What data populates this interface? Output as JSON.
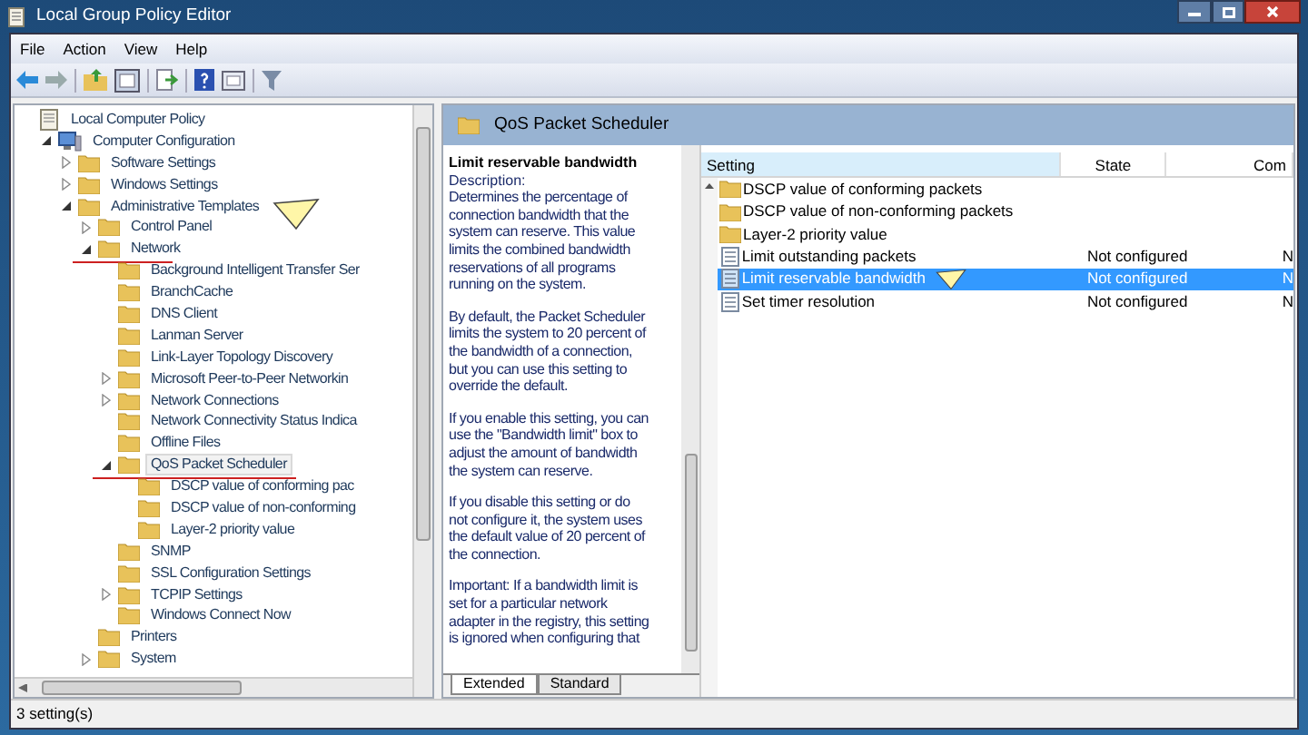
{
  "window": {
    "title": "Local Group Policy Editor"
  },
  "menu": [
    "File",
    "Action",
    "View",
    "Help"
  ],
  "tree": [
    {
      "label": "Local Computer Policy",
      "selected": false,
      "children": [
        {
          "label": "Computer Configuration",
          "expanded": true,
          "selected": false,
          "children": [
            {
              "label": "Software Settings",
              "expanded": false,
              "selected": false
            },
            {
              "label": "Windows Settings",
              "expanded": false,
              "selected": false
            },
            {
              "label": "Administrative Templates",
              "expanded": true,
              "selected": false,
              "pointer": true,
              "children": [
                {
                  "label": "Control Panel",
                  "expanded": false,
                  "selected": false
                },
                {
                  "label": "Network",
                  "expanded": true,
                  "selected": false,
                  "underlined": true,
                  "children": [
                    {
                      "label": "Background Intelligent Transfer Ser",
                      "selected": false
                    },
                    {
                      "label": "BranchCache",
                      "selected": false
                    },
                    {
                      "label": "DNS Client",
                      "selected": false
                    },
                    {
                      "label": "Lanman Server",
                      "selected": false
                    },
                    {
                      "label": "Link-Layer Topology Discovery",
                      "selected": false
                    },
                    {
                      "label": "Microsoft Peer-to-Peer Networkin",
                      "expanded": false,
                      "selected": false
                    },
                    {
                      "label": "Network Connections",
                      "expanded": false,
                      "selected": false
                    },
                    {
                      "label": "Network Connectivity Status Indica",
                      "selected": false
                    },
                    {
                      "label": "Offline Files",
                      "selected": false
                    },
                    {
                      "label": "QoS Packet Scheduler",
                      "expanded": true,
                      "selected": true,
                      "underlined": true,
                      "children": [
                        {
                          "label": "DSCP value of conforming pac",
                          "selected": false
                        },
                        {
                          "label": "DSCP value of non-conforming",
                          "selected": false
                        },
                        {
                          "label": "Layer-2 priority value",
                          "selected": false
                        }
                      ]
                    },
                    {
                      "label": "SNMP",
                      "selected": false
                    },
                    {
                      "label": "SSL Configuration Settings",
                      "selected": false
                    },
                    {
                      "label": "TCPIP Settings",
                      "expanded": false,
                      "selected": false
                    },
                    {
                      "label": "Windows Connect Now",
                      "selected": false
                    }
                  ]
                },
                {
                  "label": "Printers",
                  "selected": false
                },
                {
                  "label": "System",
                  "expanded": false,
                  "selected": false
                }
              ]
            }
          ]
        }
      ]
    }
  ],
  "pane_title": "QoS Packet Scheduler",
  "description": {
    "title": "Limit reservable bandwidth",
    "label": "Description:",
    "paragraphs": [
      [
        "Determines the percentage of",
        "connection bandwidth that the",
        "system can reserve. This value",
        "limits the combined bandwidth",
        "reservations of all programs",
        "running on the system."
      ],
      [
        "By default, the Packet Scheduler",
        "limits the system to 20 percent of",
        "the bandwidth of a connection,",
        "but you can use this setting to",
        "override the default."
      ],
      [
        "If you enable this setting, you can",
        "use the \"Bandwidth limit\" box to",
        "adjust the amount of bandwidth",
        "the system can reserve."
      ],
      [
        "If you disable this setting or do",
        "not configure it, the system uses",
        "the default value of 20 percent of",
        "the connection."
      ],
      [
        "Important: If a bandwidth limit is",
        "set for a particular network",
        "adapter in the registry, this setting",
        "is ignored when configuring that"
      ]
    ]
  },
  "table": {
    "columns": [
      "Setting",
      "State",
      "Com"
    ],
    "rows": [
      {
        "kind": "folder",
        "setting": "DSCP value of conforming packets",
        "selected": false
      },
      {
        "kind": "folder",
        "setting": "DSCP value of non-conforming packets",
        "selected": false
      },
      {
        "kind": "folder",
        "setting": "Layer-2 priority value",
        "selected": false
      },
      {
        "kind": "setting",
        "setting": "Limit outstanding packets",
        "state": "Not configured",
        "column_3": "N",
        "selected": false
      },
      {
        "kind": "setting",
        "setting": "Limit reservable bandwidth",
        "state": "Not configured",
        "column_3": "N",
        "selected": true,
        "pointer": true
      },
      {
        "kind": "setting",
        "setting": "Set timer resolution",
        "state": "Not configured",
        "column_3": "N",
        "selected": false
      }
    ]
  },
  "tabs": [
    {
      "label": "Extended",
      "selected": true
    },
    {
      "label": "Standard",
      "selected": false
    }
  ],
  "status_bar": "3 setting(s)"
}
